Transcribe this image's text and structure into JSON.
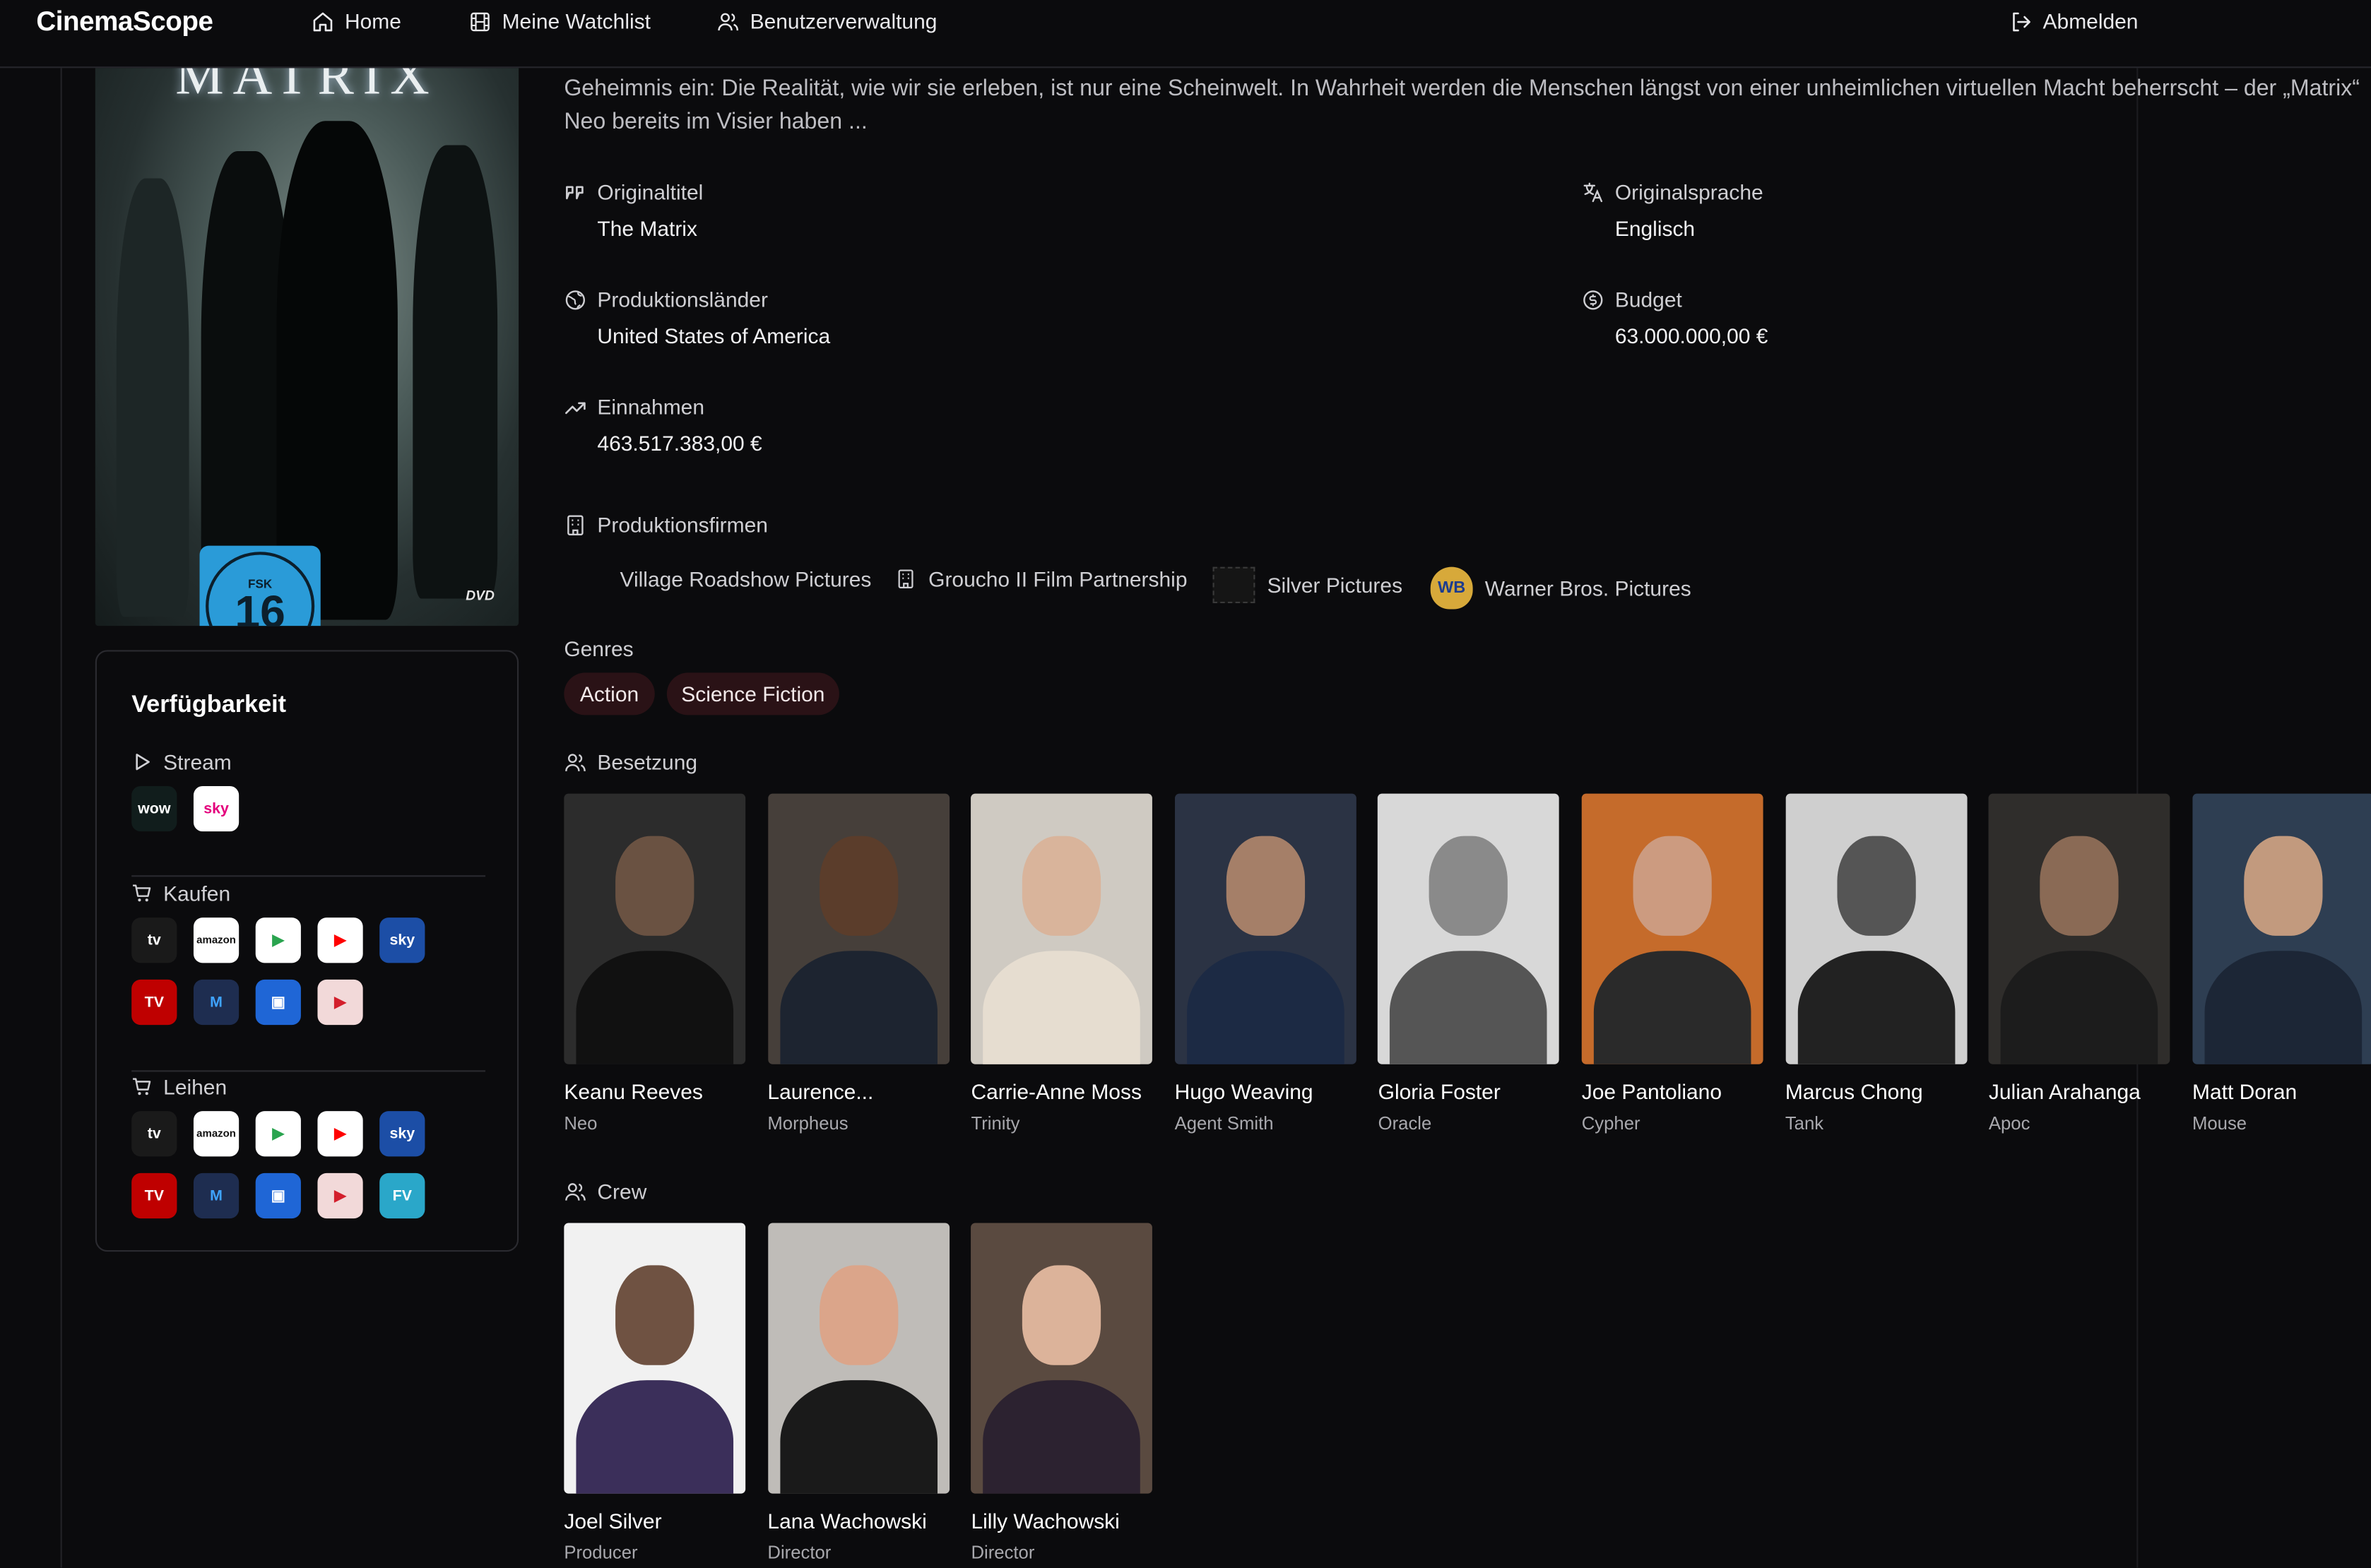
{
  "nav": {
    "brand": "CinemaScope",
    "home": "Home",
    "watchlist": "Meine Watchlist",
    "users": "Benutzerverwaltung",
    "logout": "Abmelden"
  },
  "poster": {
    "title": "MATRIX",
    "fsk_label": "FSK",
    "fsk_age": "16",
    "dvd": "DVD"
  },
  "availability": {
    "title": "Verfügbarkeit",
    "stream": {
      "label": "Stream",
      "providers": [
        {
          "name": "WOW",
          "text": "wow",
          "bg": "#111d1c",
          "fg": "#ffffff"
        },
        {
          "name": "Sky",
          "text": "sky",
          "bg": "#ffffff",
          "fg": "#e4007c"
        }
      ]
    },
    "buy": {
      "label": "Kaufen",
      "providers": [
        {
          "name": "Apple TV",
          "text": "tv",
          "bg": "#1a1a1a",
          "fg": "#ffffff"
        },
        {
          "name": "Amazon Video",
          "text": "amazon",
          "bg": "#ffffff",
          "fg": "#111111"
        },
        {
          "name": "Google Play",
          "text": "▶",
          "bg": "#ffffff",
          "fg": "#2aa44f"
        },
        {
          "name": "YouTube",
          "text": "▶",
          "bg": "#ffffff",
          "fg": "#ff0000"
        },
        {
          "name": "Sky Store",
          "text": "sky",
          "bg": "#1c4ea6",
          "fg": "#ffffff"
        },
        {
          "name": "Rakuten TV",
          "text": "TV",
          "bg": "#bf0000",
          "fg": "#ffffff"
        },
        {
          "name": "maxdome",
          "text": "M",
          "bg": "#1e2d50",
          "fg": "#3fa3ff"
        },
        {
          "name": "Microsoft Store",
          "text": "▣",
          "bg": "#1f66d6",
          "fg": "#ffffff"
        },
        {
          "name": "Chili",
          "text": "▶",
          "bg": "#f2d9d9",
          "fg": "#d31f2c"
        }
      ]
    },
    "rent": {
      "label": "Leihen",
      "providers": [
        {
          "name": "Apple TV",
          "text": "tv",
          "bg": "#1a1a1a",
          "fg": "#ffffff"
        },
        {
          "name": "Amazon Video",
          "text": "amazon",
          "bg": "#ffffff",
          "fg": "#111111"
        },
        {
          "name": "Google Play",
          "text": "▶",
          "bg": "#ffffff",
          "fg": "#2aa44f"
        },
        {
          "name": "YouTube",
          "text": "▶",
          "bg": "#ffffff",
          "fg": "#ff0000"
        },
        {
          "name": "Sky Store",
          "text": "sky",
          "bg": "#1c4ea6",
          "fg": "#ffffff"
        },
        {
          "name": "Rakuten TV",
          "text": "TV",
          "bg": "#bf0000",
          "fg": "#ffffff"
        },
        {
          "name": "maxdome",
          "text": "M",
          "bg": "#1e2d50",
          "fg": "#3fa3ff"
        },
        {
          "name": "Microsoft Store",
          "text": "▣",
          "bg": "#1f66d6",
          "fg": "#ffffff"
        },
        {
          "name": "Chili",
          "text": "▶",
          "bg": "#f2d9d9",
          "fg": "#d31f2c"
        },
        {
          "name": "Filmvision",
          "text": "FV",
          "bg": "#2aa7c9",
          "fg": "#ffffff"
        }
      ]
    }
  },
  "overview": {
    "line2": "Geheimnis ein: Die Realität, wie wir sie erleben, ist nur eine Scheinwelt. In Wahrheit werden die Menschen längst von einer unheimlichen virtuellen Macht beherrscht – der „Matrix“",
    "line3": "Neo bereits im Visier haben ..."
  },
  "facts": {
    "original_title": {
      "label": "Originaltitel",
      "value": "The Matrix"
    },
    "original_language": {
      "label": "Originalsprache",
      "value": "Englisch"
    },
    "countries": {
      "label": "Produktionsländer",
      "value": "United States of America"
    },
    "budget": {
      "label": "Budget",
      "value": "63.000.000,00 €"
    },
    "revenue": {
      "label": "Einnahmen",
      "value": "463.517.383,00 €"
    }
  },
  "companies": {
    "label": "Produktionsfirmen",
    "items": [
      "Village Roadshow Pictures",
      "Groucho II Film Partnership",
      "Silver Pictures",
      "Warner Bros. Pictures"
    ]
  },
  "genres": {
    "label": "Genres",
    "items": [
      "Action",
      "Science Fiction"
    ]
  },
  "cast": {
    "label": "Besetzung",
    "items": [
      {
        "name": "Keanu Reeves",
        "role": "Neo"
      },
      {
        "name": "Laurence...",
        "role": "Morpheus"
      },
      {
        "name": "Carrie-Anne Moss",
        "role": "Trinity"
      },
      {
        "name": "Hugo Weaving",
        "role": "Agent Smith"
      },
      {
        "name": "Gloria Foster",
        "role": "Oracle"
      },
      {
        "name": "Joe Pantoliano",
        "role": "Cypher"
      },
      {
        "name": "Marcus Chong",
        "role": "Tank"
      },
      {
        "name": "Julian Arahanga",
        "role": "Apoc"
      },
      {
        "name": "Matt Doran",
        "role": "Mouse"
      }
    ]
  },
  "crew": {
    "label": "Crew",
    "items": [
      {
        "name": "Joel Silver",
        "role": "Producer"
      },
      {
        "name": "Lana Wachowski",
        "role": "Director"
      },
      {
        "name": "Lilly Wachowski",
        "role": "Director"
      }
    ]
  }
}
